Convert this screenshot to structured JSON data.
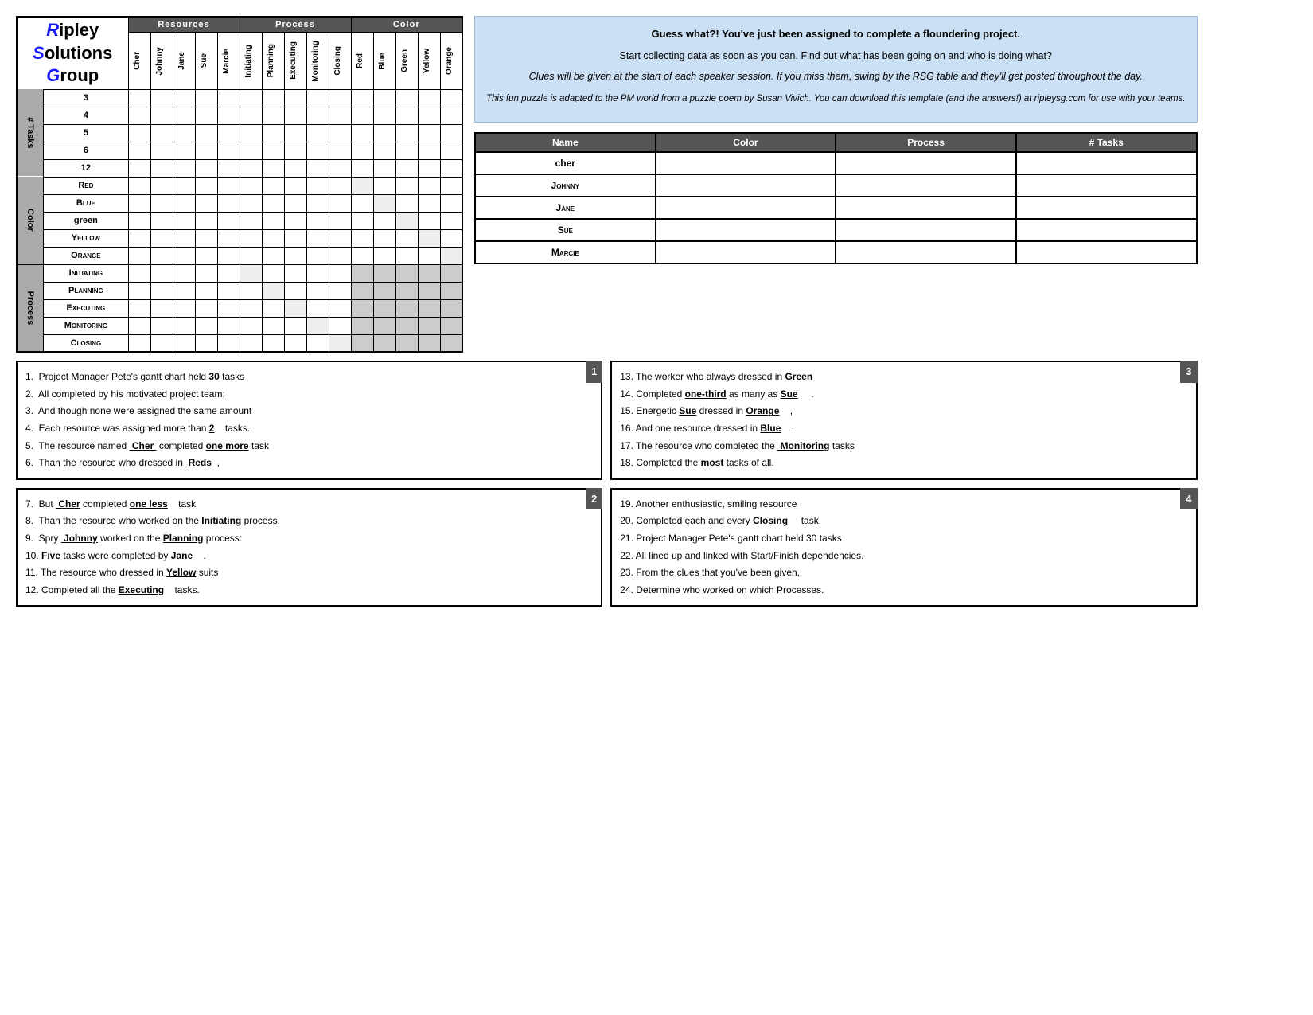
{
  "logo": {
    "line1": "ipley",
    "line2": "olutions",
    "line3": "roup"
  },
  "resources_header": "Resources",
  "process_header": "Process",
  "color_header": "Color",
  "column_headers": {
    "resources": [
      "Cher",
      "Johnny",
      "Jane",
      "Sue",
      "Marcie"
    ],
    "process": [
      "Initiating",
      "Planning",
      "Executing",
      "Monitoring",
      "Closing"
    ],
    "color": [
      "Red",
      "Blue",
      "Green",
      "Yellow",
      "Orange"
    ]
  },
  "row_groups": {
    "tasks": {
      "label": "# Tasks",
      "rows": [
        "3",
        "4",
        "5",
        "6",
        "12"
      ]
    },
    "color": {
      "label": "Color",
      "rows": [
        "Red",
        "Blue",
        "Green",
        "Yellow",
        "Orange"
      ]
    },
    "process": {
      "label": "Process",
      "rows": [
        "Initiating",
        "Planning",
        "Executing",
        "Monitoring",
        "Closing"
      ]
    }
  },
  "info_box": {
    "title": "Guess what?! You've just been assigned to complete a floundering project.",
    "para1": "Start collecting data as soon as you can.  Find out what has been going on and who is doing what?",
    "italic1": "Clues will be given at the start of each speaker session.  If you miss them, swing by the RSG table and they'll get posted throughout the day.",
    "italic2": "This fun puzzle is adapted to the PM world from a puzzle poem by Susan Vivich.  You can download this template (and the answers!) at ripleysg.com for use with your teams."
  },
  "summary_table": {
    "headers": [
      "Name",
      "Color",
      "Process",
      "# Tasks"
    ],
    "rows": [
      {
        "name": "Cher",
        "color": "",
        "process": "",
        "tasks": ""
      },
      {
        "name": "Johnny",
        "color": "",
        "process": "",
        "tasks": ""
      },
      {
        "name": "Jane",
        "color": "",
        "process": "",
        "tasks": ""
      },
      {
        "name": "Sue",
        "color": "",
        "process": "",
        "tasks": ""
      },
      {
        "name": "Marcie",
        "color": "",
        "process": "",
        "tasks": ""
      }
    ]
  },
  "clue_box_1": {
    "badge": "1",
    "clues": [
      "1.  Project Manager Pete’s gantt chart held __30__ tasks",
      "2.  All completed by his motivated project team;",
      "3.  And though none were assigned the same amount",
      "4.  Each resource was assigned more than __2____ tasks.",
      "5.  The resource named __Cher__ completed _one more_task",
      "6.  Than the resource who dressed in __Reds___ ,"
    ]
  },
  "clue_box_2": {
    "badge": "2",
    "clues": [
      "7.  But __Cher_ completed _one less_____ task",
      "8.  Than the resource who worked on the _Initiating_ process.",
      "9.  Spry __Johnny_ worked on the _Planning_ process:",
      "10. _Five_ tasks were completed by _Jane____.",
      "11. The resource who dressed in _Yellow_ suits",
      "12. Completed all the _Executing___ tasks."
    ]
  },
  "clue_box_3": {
    "badge": "3",
    "clues": [
      "13. The worker who always dressed in _Green____",
      "14. Completed _one-third_ as many as _Sue_____.",
      "15. Energetic _Sue__ dressed in _Orange____ ,",
      "16. And one resource dressed in _Blue____.",
      "17. The resource who completed the __Monitoring_ tasks",
      "18. Completed the _most_ tasks of all."
    ]
  },
  "clue_box_4": {
    "badge": "4",
    "clues": [
      "19. Another enthusiastic, smiling resource",
      "20. Completed each and every _Closing_____ task.",
      "21. Project Manager Pete’s gantt chart held 30 tasks",
      "22. All lined up and linked with Start/Finish dependencies.",
      "23. From the clues that you’ve been given,",
      "24. Determine who worked on which Processes."
    ]
  }
}
